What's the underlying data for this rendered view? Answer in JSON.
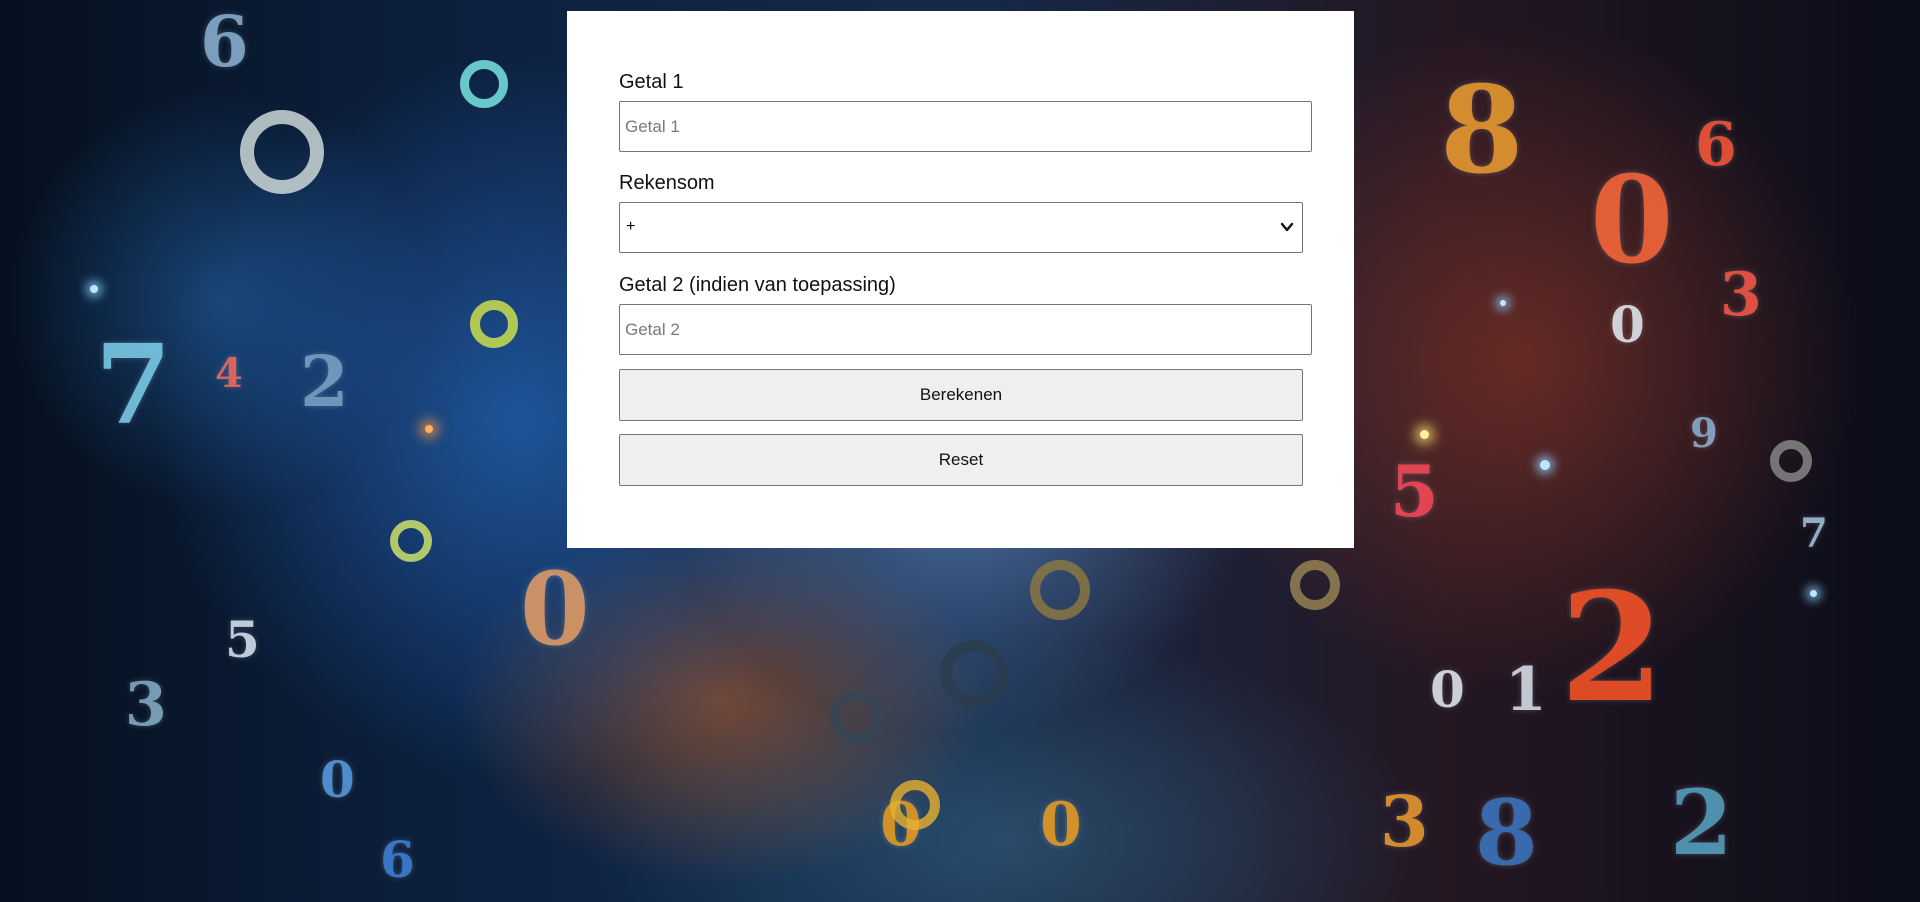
{
  "colors": {
    "panel_background": "#ffffff",
    "button_background": "#efefef",
    "input_border": "#767676"
  },
  "form": {
    "getal1": {
      "label": "Getal 1",
      "placeholder": "Getal 1",
      "value": ""
    },
    "rekensom": {
      "label": "Rekensom",
      "selected": "+"
    },
    "getal2": {
      "label": "Getal 2 (indien van toepassing)",
      "placeholder": "Getal 2",
      "value": ""
    },
    "buttons": {
      "calculate": "Berekenen",
      "reset": "Reset"
    }
  },
  "icons": {
    "select_arrow": "chevron-down-icon"
  }
}
